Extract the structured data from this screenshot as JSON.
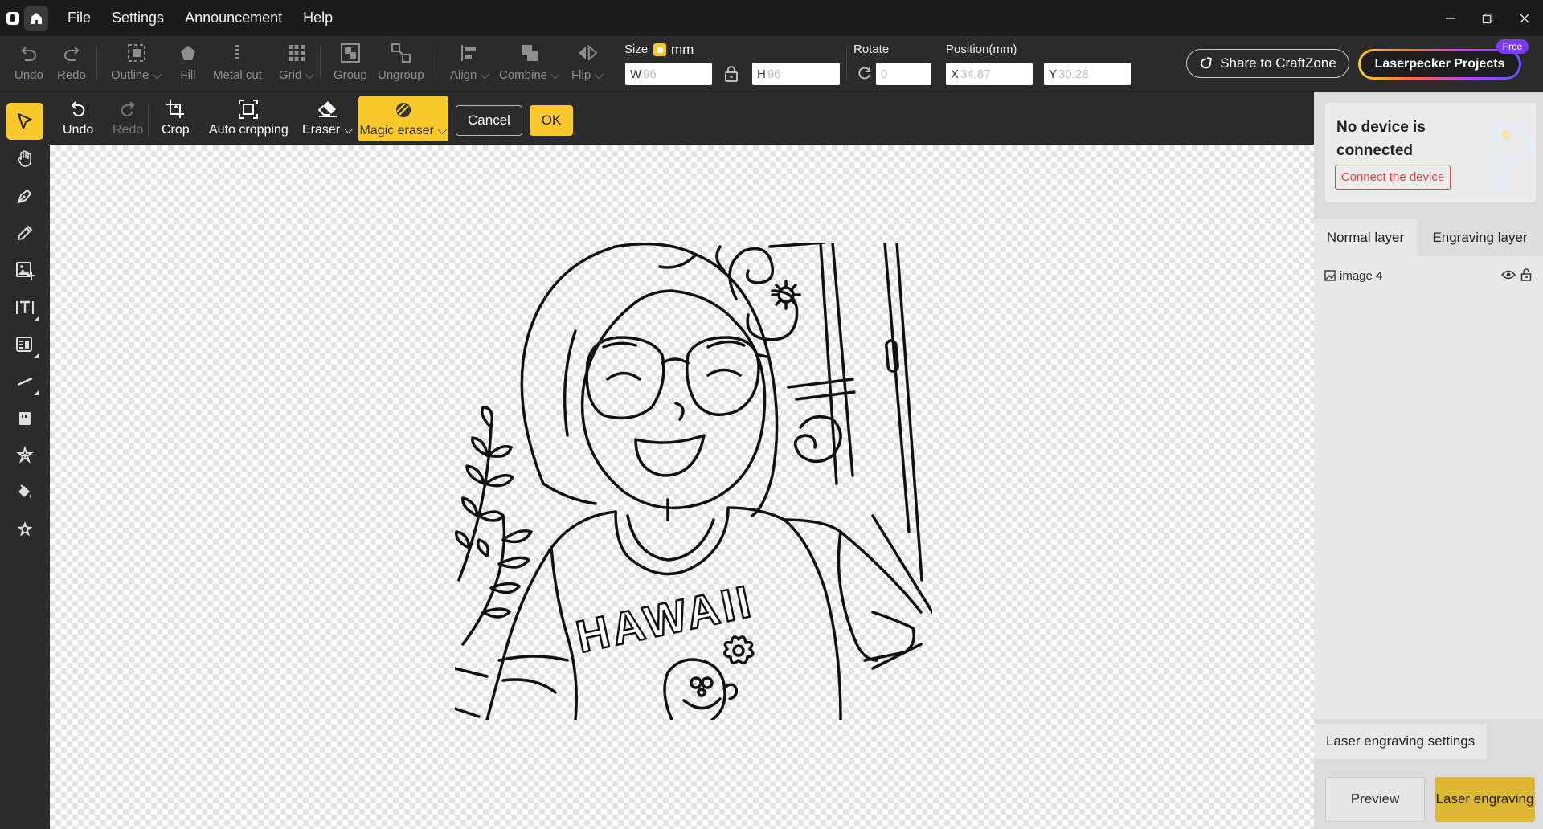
{
  "menu": {
    "file": "File",
    "settings": "Settings",
    "announcement": "Announcement",
    "help": "Help"
  },
  "toolbar": {
    "undo": "Undo",
    "redo": "Redo",
    "outline": "Outline",
    "fill": "Fill",
    "metal_cut": "Metal cut",
    "grid": "Grid",
    "group": "Group",
    "ungroup": "Ungroup",
    "align": "Align",
    "combine": "Combine",
    "flip": "Flip",
    "size_label": "Size",
    "unit": "mm",
    "w_prefix": "W",
    "w_value": "96",
    "h_prefix": "H",
    "h_value": "96",
    "rotate_label": "Rotate",
    "rotate_value": "0",
    "position_label": "Position(mm)",
    "x_prefix": "X",
    "x_value": "34.87",
    "y_prefix": "Y",
    "y_value": "30.28",
    "share": "Share to CraftZone",
    "projects": "Laserpecker Projects",
    "free_badge": "Free"
  },
  "edit_toolbar": {
    "undo": "Undo",
    "redo": "Redo",
    "crop": "Crop",
    "auto_cropping": "Auto cropping",
    "eraser": "Eraser",
    "magic_eraser": "Magic eraser",
    "cancel": "Cancel",
    "ok": "OK"
  },
  "artwork": {
    "shirt_text": "HAWAII"
  },
  "right_panel": {
    "device_status": "No device is connected",
    "connect": "Connect the device",
    "tab_normal": "Normal layer",
    "tab_engraving": "Engraving layer",
    "layers": [
      {
        "name": "image 4"
      }
    ],
    "laser_settings": "Laser engraving settings",
    "preview": "Preview",
    "laser_engraving": "Laser engraving"
  },
  "colors": {
    "accent": "#f9c92c",
    "danger": "#e04848",
    "dark": "#2b2b2b"
  }
}
